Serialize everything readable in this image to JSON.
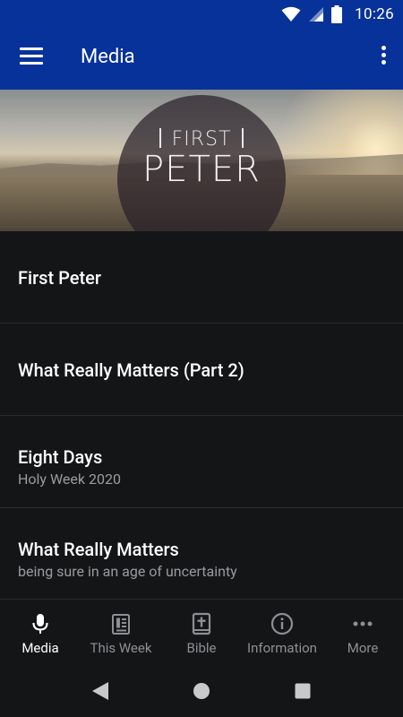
{
  "status_bar": {
    "time": "10:26",
    "icons": [
      "wifi-icon",
      "cellular-signal-icon",
      "battery-icon"
    ]
  },
  "app_bar": {
    "title": "Media",
    "icons": [
      "menu-icon",
      "overflow-menu-icon"
    ]
  },
  "banner": {
    "title_small": "FIRST",
    "title_large": "PETER"
  },
  "media_list": [
    {
      "title": "First Peter",
      "subtitle": ""
    },
    {
      "title": "What Really Matters (Part 2)",
      "subtitle": ""
    },
    {
      "title": "Eight Days",
      "subtitle": "Holy Week 2020"
    },
    {
      "title": "What Really Matters",
      "subtitle": "being sure in an age of uncertainty"
    }
  ],
  "bottom_nav": [
    {
      "label": "Media",
      "icon": "microphone-icon",
      "active": true
    },
    {
      "label": "This Week",
      "icon": "bulletin-icon",
      "active": false
    },
    {
      "label": "Bible",
      "icon": "bible-icon",
      "active": false
    },
    {
      "label": "Information",
      "icon": "info-icon",
      "active": false
    },
    {
      "label": "More",
      "icon": "more-dots-icon",
      "active": false
    }
  ],
  "system_nav": [
    "back-icon",
    "home-icon",
    "recents-icon"
  ],
  "colors": {
    "app_bar": "#07329a",
    "background": "#141517",
    "divider": "#2a2b2e",
    "inactive": "#8e8f92"
  }
}
